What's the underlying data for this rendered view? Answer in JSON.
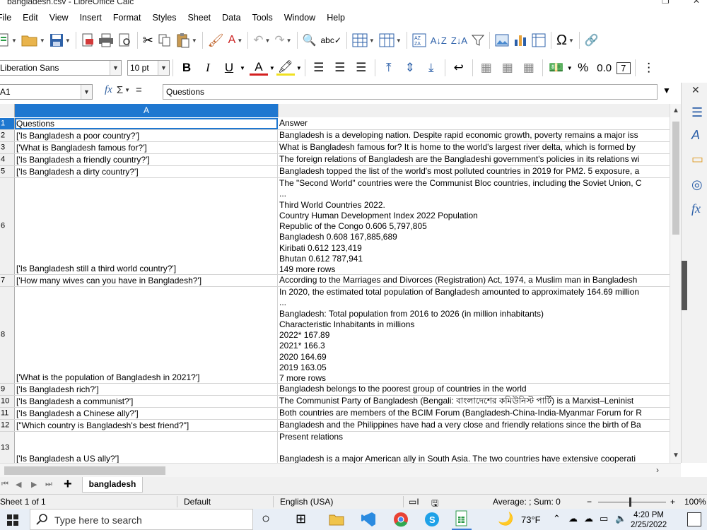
{
  "window": {
    "title": "bangladesh.csv - LibreOffice Calc"
  },
  "menu": [
    "File",
    "Edit",
    "View",
    "Insert",
    "Format",
    "Styles",
    "Sheet",
    "Data",
    "Tools",
    "Window",
    "Help"
  ],
  "font": {
    "name": "Liberation Sans",
    "size": "10 pt"
  },
  "formula_bar": {
    "cell_ref": "A1",
    "content": "Questions"
  },
  "column_header": "A",
  "rows": [
    {
      "num": "1",
      "a": "Questions",
      "b": [
        "Answer"
      ],
      "height": 17
    },
    {
      "num": "2",
      "a": "['Is Bangladesh a poor country?']",
      "b": [
        "Bangladesh is a developing nation. Despite rapid economic growth, poverty remains a major iss"
      ],
      "height": 17
    },
    {
      "num": "3",
      "a": "['What is Bangladesh famous for?']",
      "b": [
        "What is Bangladesh famous for? It is home to the world's largest river delta, which is formed by"
      ],
      "height": 17
    },
    {
      "num": "4",
      "a": "['Is Bangladesh a friendly country?']",
      "b": [
        "The foreign relations of Bangladesh are the Bangladeshi government's policies in its relations wi"
      ],
      "height": 17
    },
    {
      "num": "5",
      "a": "['Is Bangladesh a dirty country?']",
      "b": [
        "Bangladesh topped the list of the world's most polluted countries in 2019 for PM2. 5 exposure, a"
      ],
      "height": 17
    },
    {
      "num": "6",
      "a": "['Is Bangladesh still a third world country?']",
      "b": [
        "The \"Second World\" countries were the Communist Bloc countries, including the Soviet Union, C",
        "...",
        "Third World Countries 2022.",
        "Country Human Development Index 2022 Population",
        "Republic of the Congo 0.606 5,797,805",
        "Bangladesh 0.608 167,885,689",
        "Kiribati 0.612 123,419",
        "Bhutan 0.612 787,941",
        "149 more rows"
      ],
      "height": 137
    },
    {
      "num": "7",
      "a": "['How many wives can you have in Bangladesh?']",
      "b": [
        "According to the Marriages and Divorces (Registration) Act, 1974, a Muslim man in Bangladesh"
      ],
      "height": 17
    },
    {
      "num": "8",
      "a": "['What is the population of Bangladesh in 2021?']",
      "b": [
        "In 2020, the estimated total population of Bangladesh amounted to approximately 164.69 million",
        "...",
        "Bangladesh: Total population from 2016 to 2026 (in million inhabitants)",
        "Characteristic Inhabitants in millions",
        "2022* 167.89",
        "2021* 166.3",
        "2020 164.69",
        "2019 163.05",
        "7 more rows"
      ],
      "height": 137
    },
    {
      "num": "9",
      "a": "['Is Bangladesh rich?']",
      "b": [
        "Bangladesh belongs to the poorest group of countries in the world"
      ],
      "height": 17
    },
    {
      "num": "10",
      "a": "['Is Bangladesh a communist?']",
      "b": [
        "The Communist Party of Bangladesh (Bengali: বাংলাদেশের কমিউনিস্ট পার্টি) is a Marxist–Leninist"
      ],
      "height": 17
    },
    {
      "num": "11",
      "a": "['Is Bangladesh a Chinese ally?']",
      "b": [
        "Both countries are members of the BCIM Forum (Bangladesh-China-India-Myanmar Forum for R"
      ],
      "height": 17
    },
    {
      "num": "12",
      "a": "[\"Which country is Bangladesh's best friend?\"]",
      "b": [
        "Bangladesh and the Philippines have had a very close and friendly relations since the birth of Ba"
      ],
      "height": 17
    },
    {
      "num": "13",
      "a": "['Is Bangladesh a US ally?']",
      "b": [
        "Present relations",
        "",
        "Bangladesh is a major American ally in South Asia. The two countries have extensive cooperati"
      ],
      "height": 47
    }
  ],
  "sheet_tab": "bangladesh",
  "status": {
    "sheet": "Sheet 1 of 1",
    "style": "Default",
    "language": "English (USA)",
    "summary": "Average: ; Sum: 0",
    "zoom": "100%"
  },
  "taskbar": {
    "search_placeholder": "Type here to search",
    "temperature": "73°F",
    "time": "4:20 PM",
    "date": "2/25/2022"
  }
}
